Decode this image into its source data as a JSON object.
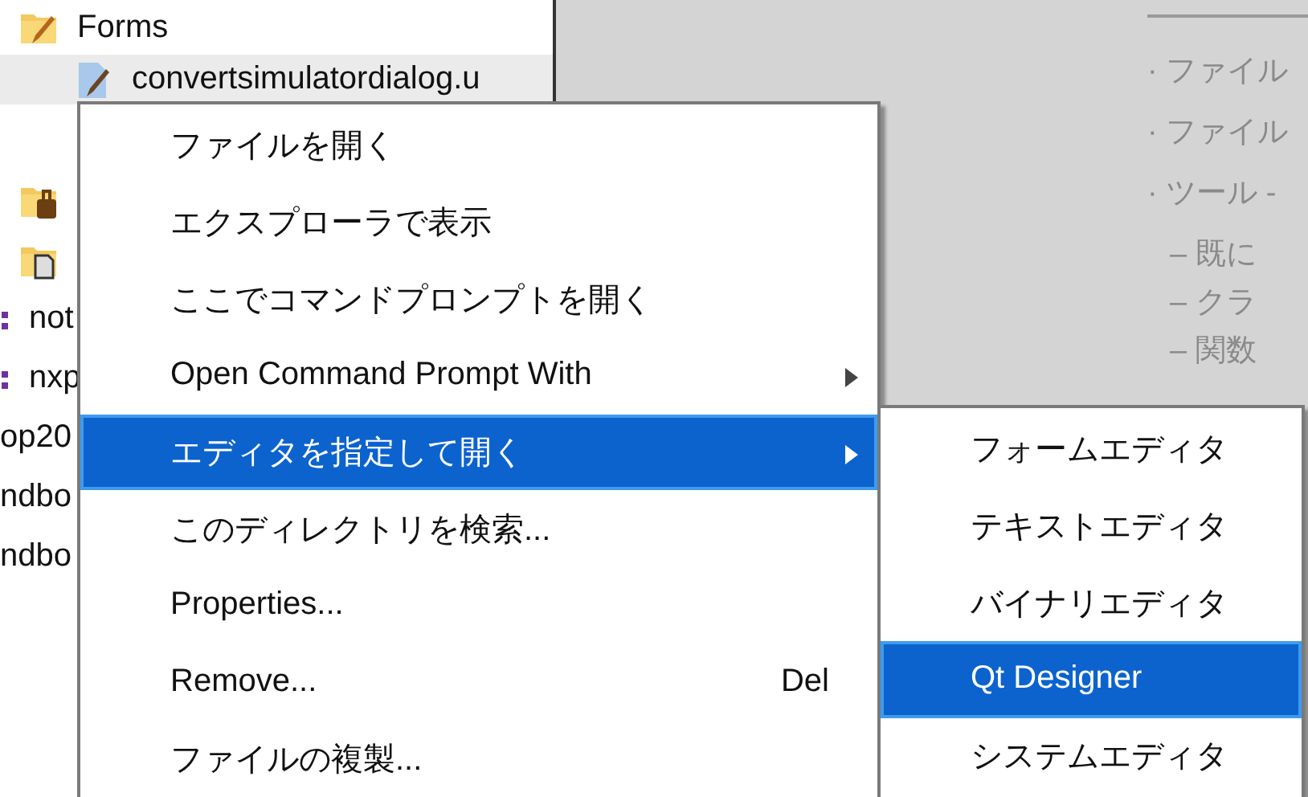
{
  "tree": {
    "items": [
      {
        "kind": "folder-pen",
        "label": "Forms",
        "selected": false,
        "children": [
          {
            "kind": "file-pen",
            "label": "convertsimulatordialog.u",
            "selected": true
          }
        ]
      },
      {
        "kind": "folder-lock",
        "selected": false
      },
      {
        "kind": "folder-copy",
        "selected": false
      },
      {
        "kind": "dots",
        "label": "not",
        "selected": false
      },
      {
        "kind": "dots",
        "label": "nxp",
        "selected": false
      },
      {
        "kind": "plain",
        "label": "op20",
        "selected": false
      },
      {
        "kind": "plain",
        "label": "ndbo",
        "selected": false
      },
      {
        "kind": "plain",
        "label": "ndbo",
        "selected": false
      }
    ]
  },
  "document": {
    "lines": [
      {
        "kind": "bullet",
        "text": "· ファイル"
      },
      {
        "kind": "bullet",
        "text": "· ファイル"
      },
      {
        "kind": "bullet",
        "text": "· ツール -"
      },
      {
        "kind": "sub",
        "text": "– 既に"
      },
      {
        "kind": "sub",
        "text": "– クラ"
      },
      {
        "kind": "sub",
        "text": "– 関数"
      }
    ]
  },
  "context_menu": {
    "items": [
      {
        "label": "ファイルを開く",
        "selected": false,
        "submenu": false
      },
      {
        "label": "エクスプローラで表示",
        "selected": false,
        "submenu": false
      },
      {
        "label": "ここでコマンドプロンプトを開く",
        "selected": false,
        "submenu": false
      },
      {
        "label": "Open Command Prompt With",
        "selected": false,
        "submenu": true
      },
      {
        "label": "エディタを指定して開く",
        "selected": true,
        "submenu": true
      },
      {
        "label": "このディレクトリを検索...",
        "selected": false,
        "submenu": false
      },
      {
        "label": "Properties...",
        "selected": false,
        "submenu": false
      },
      {
        "label": "Remove...",
        "selected": false,
        "submenu": false,
        "shortcut": "Del"
      },
      {
        "label": "ファイルの複製...",
        "selected": false,
        "submenu": false
      }
    ]
  },
  "submenu": {
    "items": [
      {
        "label": "フォームエディタ",
        "selected": false
      },
      {
        "label": "テキストエディタ",
        "selected": false
      },
      {
        "label": "バイナリエディタ",
        "selected": false
      },
      {
        "label": "Qt Designer",
        "selected": true
      },
      {
        "label": "システムエディタ",
        "selected": false
      }
    ]
  }
}
